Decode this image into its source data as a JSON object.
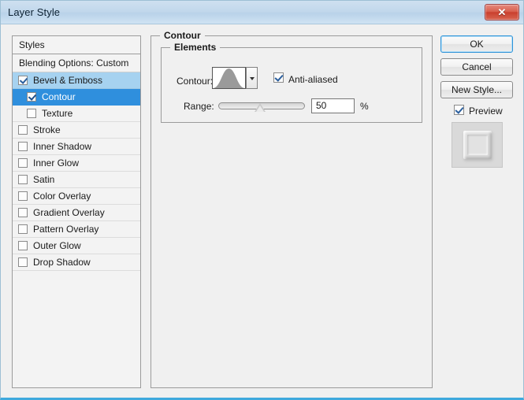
{
  "window": {
    "title": "Layer Style",
    "close_label": "✕"
  },
  "styles_panel": {
    "header": "Styles",
    "blending_options": "Blending Options: Custom",
    "items": [
      {
        "label": "Bevel & Emboss",
        "checked": true,
        "selected": "light",
        "indent": false
      },
      {
        "label": "Contour",
        "checked": true,
        "selected": "strong",
        "indent": true
      },
      {
        "label": "Texture",
        "checked": false,
        "selected": "none",
        "indent": true
      },
      {
        "label": "Stroke",
        "checked": false,
        "selected": "none",
        "indent": false
      },
      {
        "label": "Inner Shadow",
        "checked": false,
        "selected": "none",
        "indent": false
      },
      {
        "label": "Inner Glow",
        "checked": false,
        "selected": "none",
        "indent": false
      },
      {
        "label": "Satin",
        "checked": false,
        "selected": "none",
        "indent": false
      },
      {
        "label": "Color Overlay",
        "checked": false,
        "selected": "none",
        "indent": false
      },
      {
        "label": "Gradient Overlay",
        "checked": false,
        "selected": "none",
        "indent": false
      },
      {
        "label": "Pattern Overlay",
        "checked": false,
        "selected": "none",
        "indent": false
      },
      {
        "label": "Outer Glow",
        "checked": false,
        "selected": "none",
        "indent": false
      },
      {
        "label": "Drop Shadow",
        "checked": false,
        "selected": "none",
        "indent": false
      }
    ]
  },
  "contour_panel": {
    "group_title": "Contour",
    "elements_title": "Elements",
    "contour_label": "Contour:",
    "contour_preview_icon": "bell-curve-contour",
    "contour_dropdown_icon": "chevron-down-icon",
    "anti_aliased_label": "Anti-aliased",
    "anti_aliased_checked": true,
    "range_label": "Range:",
    "range_value": "50",
    "range_percent_sign": "%",
    "range_slider_position": 50
  },
  "buttons": {
    "ok": "OK",
    "cancel": "Cancel",
    "new_style": "New Style...",
    "preview_label": "Preview",
    "preview_checked": true
  },
  "colors": {
    "accent_selected": "#2f8fdd",
    "accent_light": "#a6d2f0",
    "titlebar": "#c2d8ec",
    "close_button": "#c9402f",
    "dialog_bg": "#f0f0f0",
    "bottom_border": "#3fa9dd"
  }
}
